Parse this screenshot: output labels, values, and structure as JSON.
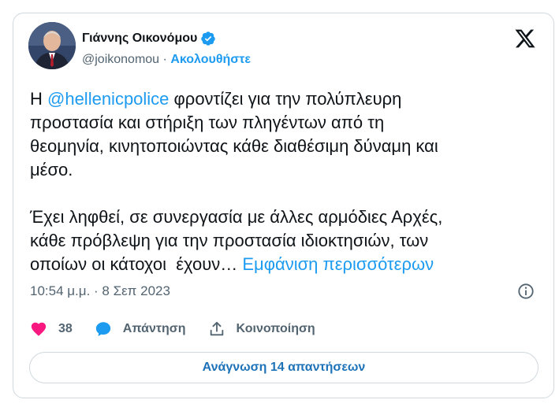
{
  "author": {
    "name": "Γιάννης Οικονόμου",
    "handle": "@joikonomou",
    "separator": "·",
    "follow_label": "Ακολουθήστε"
  },
  "tweet": {
    "prefix": "Η ",
    "mention": "@hellenicpolice",
    "text_1": " φροντίζει για την πολύπλευρη\nπροστασία και στήριξη των πληγέντων από τη\nθεομηνία, κινητοποιώντας κάθε διαθέσιμη δύναμη και\nμέσο.\n\nΈχει ληφθεί, σε συνεργασία με άλλες αρμόδιες Αρχές,\nκάθε πρόβλεψη για την προστασία ιδιοκτησιών, των\nοποίων οι κάτοχοι  έχουν… ",
    "show_more": "Εμφάνιση περισσότερων"
  },
  "timestamp": "10:54 μ.μ. · 8 Σεπ 2023",
  "actions": {
    "like_count": "38",
    "reply_label": "Απάντηση",
    "share_label": "Κοινοποίηση"
  },
  "read_replies_label": "Ανάγνωση 14 απαντήσεων",
  "icons": {
    "verified": "verified-badge-icon",
    "x_logo": "x-logo-icon",
    "info": "info-icon",
    "like": "heart-icon",
    "reply": "reply-bubble-icon",
    "share": "share-upload-icon"
  },
  "colors": {
    "accent": "#1d9bf0",
    "like": "#f91880",
    "muted": "#536471",
    "border": "#cfd9de"
  }
}
